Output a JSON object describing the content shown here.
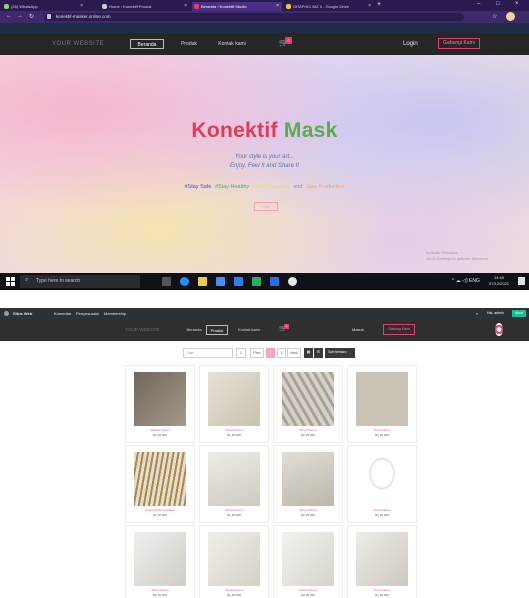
{
  "screen1": {
    "tabs": [
      {
        "label": "(28) WhatsApp"
      },
      {
        "label": "Home ‹ Konektif Produk"
      },
      {
        "label": "Beranda ‹ Konektif Studio"
      },
      {
        "label": "GRAPHIC BIZ II - Google Drive"
      }
    ],
    "url": "konektif-masker.online.com",
    "nav": {
      "brand": "YOUR WEBSITE",
      "links": [
        {
          "label": "Beranda",
          "active": true
        },
        {
          "label": "Produk",
          "active": false
        },
        {
          "label": "Kontak kami",
          "active": false
        }
      ],
      "cart_count": "0",
      "login": "Login",
      "join": "Gabungi Kami"
    },
    "hero": {
      "title_part1": "Konektif",
      "title_part2": "Mask",
      "tagline1": "Your style is your art...",
      "tagline2": "Enjoy, Feel It and Share It",
      "hashtags": [
        {
          "text": "#Stay Safe",
          "color": "#3b4fd8"
        },
        {
          "text": "#Stay Healthy",
          "color": "#4caf50"
        },
        {
          "text": "#Stay Beautiful",
          "color": "#f5d94a"
        },
        {
          "text": "and",
          "color": "#9a7fd6"
        },
        {
          "text": "Stay Productive",
          "color": "#f4a259"
        }
      ],
      "button": "Lihat",
      "activate_line1": "Activate Windows",
      "activate_line2": "Go to Settings to activate Windows."
    },
    "taskbar": {
      "search_placeholder": "Type here to search",
      "tray": "^ ☁ ◁) ENG",
      "time": "14:45",
      "date": "07/12/2021"
    }
  },
  "screen2": {
    "wpbar": {
      "site": "Situs Web",
      "items": [
        "Komentar",
        "Penyesuaian",
        "Membership"
      ],
      "right_label": "Hai, admin",
      "extra": "Akun"
    },
    "nav": {
      "brand": "YOUR WEBSITE",
      "links": [
        {
          "label": "Beranda",
          "active": false
        },
        {
          "label": "Produk",
          "active": true
        },
        {
          "label": "Kontak kami",
          "active": false
        }
      ],
      "cart_count": "0",
      "login": "Masuk",
      "join": "Gabung Kami"
    },
    "toolbar": {
      "search_placeholder": "Cari",
      "pages": [
        "1",
        "Prev",
        "2",
        "3",
        "Next"
      ],
      "current_page": "2",
      "sort": "Sort terbaru"
    },
    "products": [
      {
        "name": "Masker Sarimi",
        "price": "Rp 25.000",
        "img_color": "#8c8478"
      },
      {
        "name": "Strap Kalung",
        "price": "Rp 30.000",
        "img_color": "#d7d2c3"
      },
      {
        "name": "Strap Kalung",
        "price": "Rp 30.000",
        "img_color": "#bdb7ad"
      },
      {
        "name": "Strap Kalung",
        "price": "Rp 30.000",
        "img_color": "#c9c3b6"
      },
      {
        "name": "Gelang Kalung Masker",
        "price": "Rp 30.000",
        "img_color": "#b9a884"
      },
      {
        "name": "Strap Kalung",
        "price": "Rp 30.000",
        "img_color": "#ddd9cf"
      },
      {
        "name": "Strap Kalung",
        "price": "Rp 30.000",
        "img_color": "#d3cec2"
      },
      {
        "name": "Strap Kalung",
        "price": "Rp 30.000",
        "img_color": "#e3e1dc"
      },
      {
        "name": "Strap Kalung",
        "price": "Rp 30.000",
        "img_color": "#c8c6c0"
      },
      {
        "name": "Strap Kalung",
        "price": "Rp 30.000",
        "img_color": "#d9d5cc"
      },
      {
        "name": "Strap Kalung",
        "price": "Rp 30.000",
        "img_color": "#dcd9d3"
      },
      {
        "name": "Strap Kalung",
        "price": "Rp 30.000",
        "img_color": "#d1cdc4"
      }
    ]
  }
}
